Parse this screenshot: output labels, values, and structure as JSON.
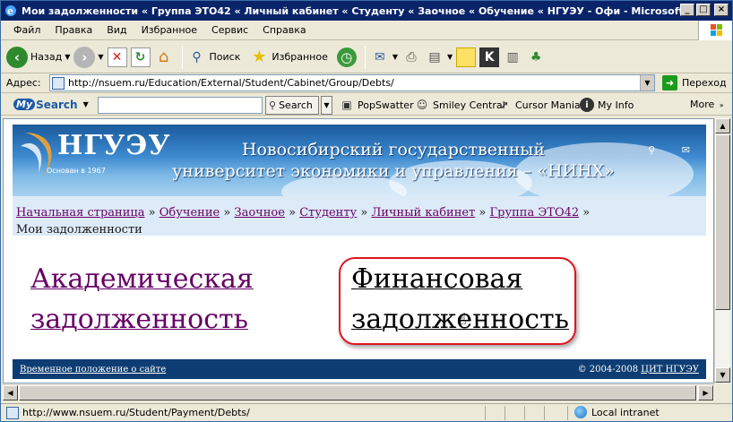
{
  "window": {
    "title": "Мои задолженности « Группа ЭТО42 « Личный кабинет « Студенту « Заочное « Обучение « НГУЭУ - Офи - Microsoft Internet..."
  },
  "menu": [
    "Файл",
    "Правка",
    "Вид",
    "Избранное",
    "Сервис",
    "Справка"
  ],
  "toolbar": {
    "back_label": "Назад",
    "search_label": "Поиск",
    "favorites_label": "Избранное"
  },
  "address": {
    "label": "Адрес:",
    "url": "http://nsuem.ru/Education/External/Student/Cabinet/Group/Debts/",
    "go_label": "Переход"
  },
  "searchbar": {
    "logo_my": "My",
    "logo_search": "Search",
    "button_label": "Search",
    "tools": [
      "PopSwatter",
      "Smiley Central",
      "Cursor Mania",
      "My Info"
    ],
    "more_label": "More"
  },
  "page": {
    "logo_text": "НГУЭУ",
    "logo_founded": "Основан в 1967",
    "university_line1": "Новосибирский государственный",
    "university_line2": "университет экономики и управления – «НИНХ»",
    "breadcrumbs": [
      "Начальная страница",
      "Обучение",
      "Заочное",
      "Студенту",
      "Личный кабинет",
      "Группа ЭТО42"
    ],
    "crumb_sep": "»",
    "current_page": "Мои задолженности",
    "academic_debt_line1": "Академическая",
    "academic_debt_line2": "задолженность",
    "financial_debt_line1": "Финансовая",
    "financial_debt_line2": "задолженность",
    "footer_left": "Временное положение о сайте",
    "footer_copyright": "© 2004-2008",
    "footer_link": "ЦИТ НГУЭУ"
  },
  "status": {
    "text": "http://www.nsuem.ru/Student/Payment/Debts/",
    "zone": "Local intranet"
  }
}
